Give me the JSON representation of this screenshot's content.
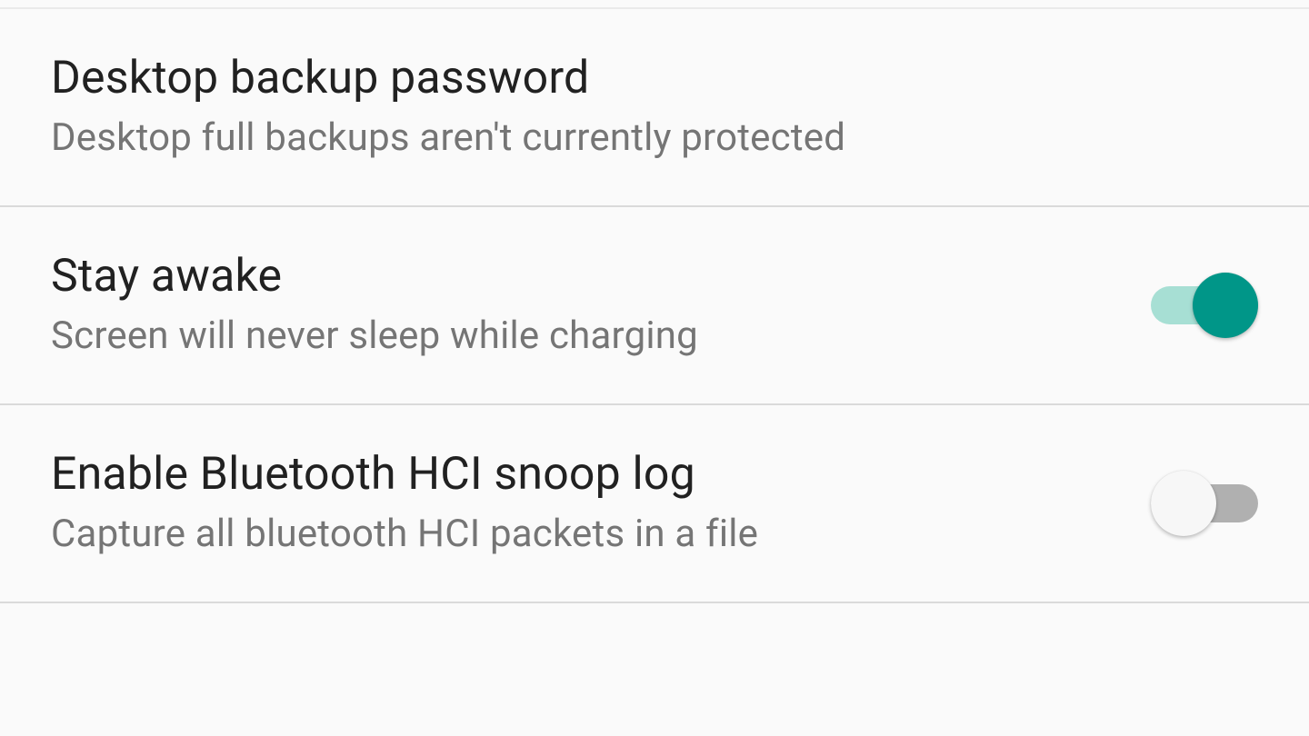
{
  "settings": [
    {
      "title": "Desktop backup password",
      "subtitle": "Desktop full backups aren't currently protected",
      "has_toggle": false
    },
    {
      "title": "Stay awake",
      "subtitle": "Screen will never sleep while charging",
      "has_toggle": true,
      "toggle_on": true
    },
    {
      "title": "Enable Bluetooth HCI snoop log",
      "subtitle": "Capture all bluetooth HCI packets in a file",
      "has_toggle": true,
      "toggle_on": false
    }
  ],
  "colors": {
    "accent": "#009688",
    "accent_track": "#a7dfd4",
    "off_track": "#b0b0b0",
    "off_thumb": "#f7f7f7",
    "text_primary": "#212121",
    "text_secondary": "#757575",
    "divider": "#dadada",
    "background": "#fafafa"
  }
}
